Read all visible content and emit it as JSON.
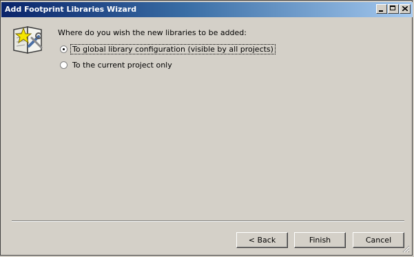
{
  "window": {
    "title": "Add Footprint Libraries Wizard",
    "caption_buttons": [
      "minimize-icon",
      "maximize-icon",
      "close-icon"
    ]
  },
  "content": {
    "question": "Where do you wish the new libraries to be added:",
    "options": [
      {
        "label": "To global library configuration (visible by all projects)",
        "checked": true
      },
      {
        "label": "To the current project only",
        "checked": false
      }
    ]
  },
  "buttons": {
    "back": "< Back",
    "finish": "Finish",
    "cancel": "Cancel"
  },
  "icons": {
    "wizard": "wizard-book-icon"
  },
  "colors": {
    "titlebar_start": "#0a246a",
    "titlebar_end": "#a6caf0",
    "dialog_bg": "#d4d0c8"
  }
}
